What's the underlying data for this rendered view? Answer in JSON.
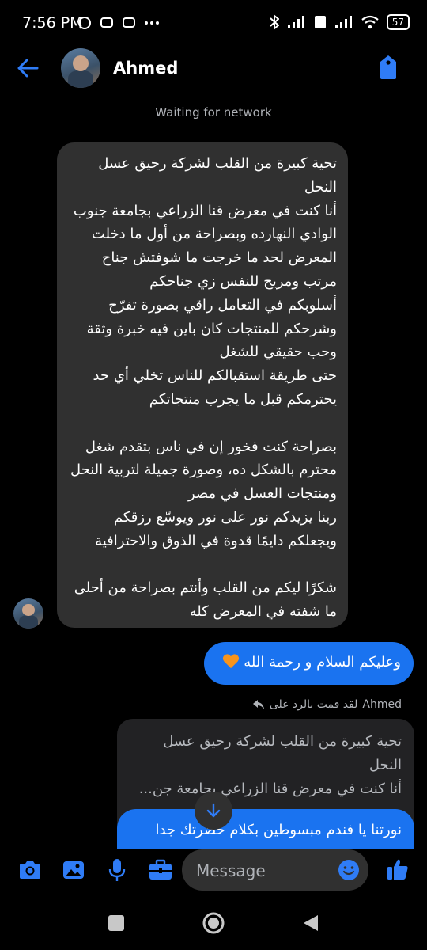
{
  "status_bar": {
    "time": "7:56 PM",
    "battery": "57",
    "icons": [
      "whatsapp-icon",
      "message-icon",
      "message-icon",
      "more-dots-icon",
      "bluetooth-icon",
      "signal-icon",
      "volte-icon",
      "signal-icon",
      "wifi-icon",
      "battery-icon"
    ]
  },
  "header": {
    "contact_name": "Ahmed",
    "back_icon": "back-arrow-icon",
    "action_icon": "tag-icon"
  },
  "network_status": "Waiting for network",
  "messages": [
    {
      "direction": "incoming",
      "text": "تحية كبيرة من القلب لشركة رحيق عسل النحل\nأنا كنت في معرض قنا الزراعي بجامعة جنوب الوادي النهارده وبصراحة من أول ما دخلت المعرض لحد ما خرجت ما شوفتش جناح مرتب ومريح للنفس زي جناحكم\nأسلوبكم في التعامل راقي بصورة تفرّح وشرحكم للمنتجات كان باين فيه خبرة وثقة وحب حقيقي للشغل\nحتى طريقة استقبالكم للناس تخلي أي حد يحترمكم قبل ما يجرب منتجاتكم\n\nبصراحة كنت فخور إن في ناس بتقدم شغل محترم بالشكل ده، وصورة جميلة لتربية النحل ومنتجات العسل في مصر\nربنا يزيدكم نور على نور ويوسّع رزقكم ويجعلكم دايمًا قدوة في الذوق والاحترافية\n\nشكرًا ليكم من القلب وأنتم بصراحة من أحلى ما شفته في المعرض كله"
    },
    {
      "direction": "outgoing",
      "text": "وعليكم السلام و رحمة الله",
      "emoji": "orange-heart"
    }
  ],
  "reply": {
    "label_prefix": "لقد قمت بالرد على",
    "label_name": "Ahmed",
    "quoted_text": "تحية كبيرة من القلب لشركة رحيق عسل النحل\nأنا كنت في معرض قنا الزراعي بجامعة جن...",
    "reply_text": "نورتنا يا فندم مبسوطين بكلام حضرتك جدا"
  },
  "composer": {
    "placeholder": "Message",
    "icons": [
      "camera-icon",
      "image-icon",
      "microphone-icon",
      "briefcase-icon",
      "emoji-icon",
      "thumbs-up-icon"
    ]
  },
  "colors": {
    "accent": "#1a73f0",
    "background": "#000000",
    "incoming_bubble": "#303030"
  }
}
